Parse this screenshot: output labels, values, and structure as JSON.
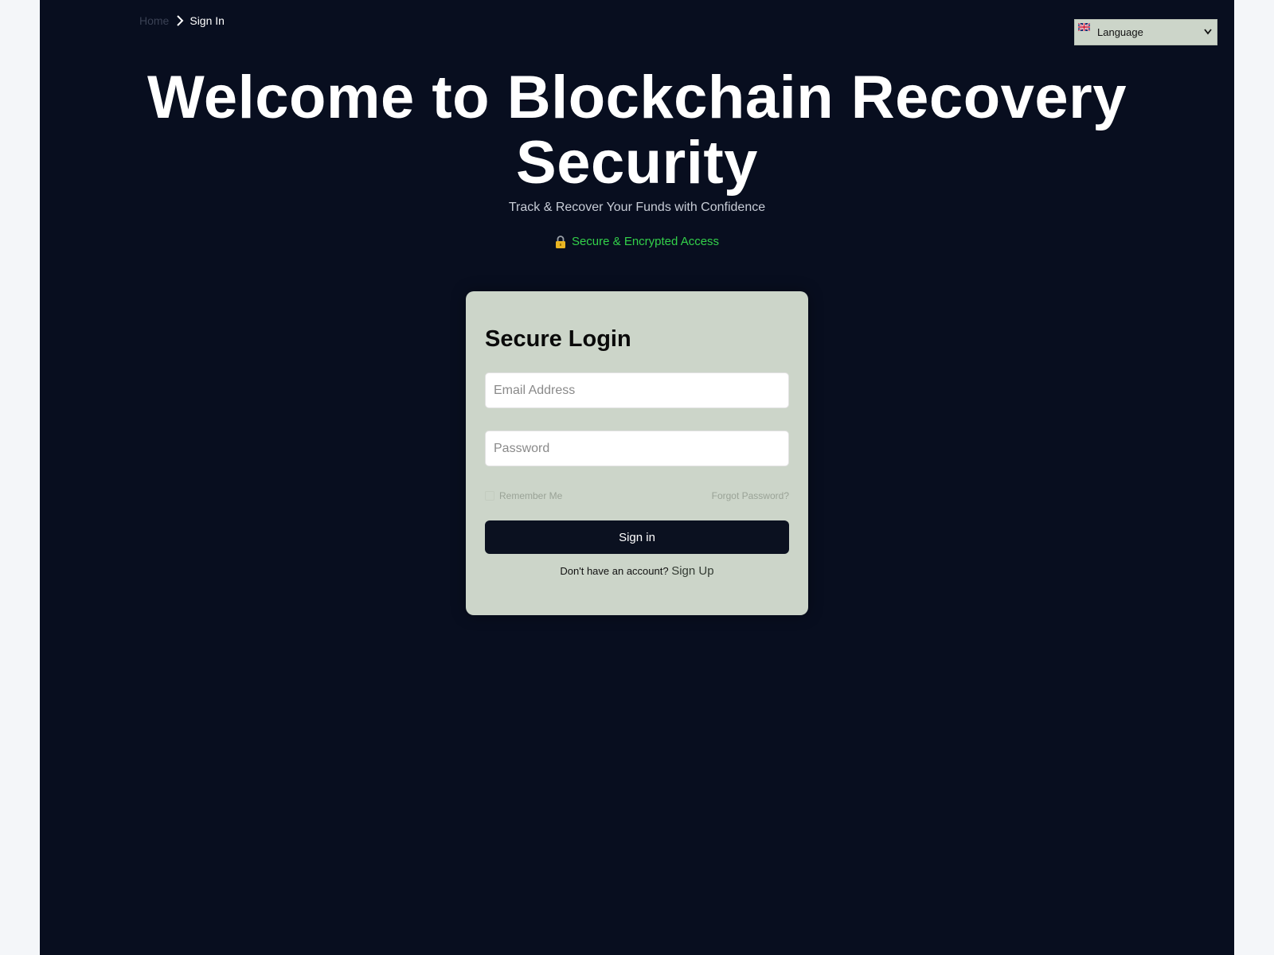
{
  "breadcrumb": {
    "home": "Home",
    "current": "Sign In",
    "separator_icon": "chevron-right-icon"
  },
  "language": {
    "selected": "Language",
    "flag_icon": "uk-flag-icon"
  },
  "hero": {
    "title": "Welcome to Blockchain Recovery Security",
    "subtitle": "Track & Recover Your Funds with Confidence",
    "secure_note": "Secure & Encrypted Access",
    "secure_color": "#33d14a"
  },
  "login": {
    "title": "Secure Login",
    "email_placeholder": "Email Address",
    "email_value": "",
    "password_placeholder": "Password",
    "password_value": "",
    "remember_label": "Remember Me",
    "remember_checked": false,
    "forgot_label": "Forgot Password?",
    "submit_label": "Sign in",
    "signup_prompt": "Don't have an account?",
    "signup_label": "Sign Up"
  },
  "colors": {
    "background": "#080e1f",
    "card": "#ccd5c9",
    "button": "#0b1120",
    "text_on_dark": "#ffffff"
  }
}
